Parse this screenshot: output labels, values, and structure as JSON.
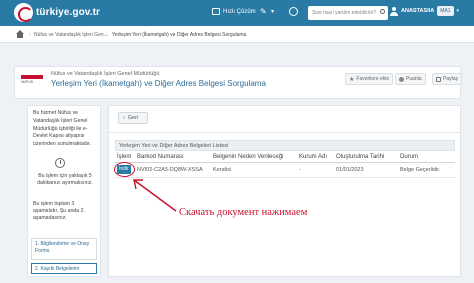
{
  "header": {
    "logo_text": "türkiye.gov.tr",
    "quick_solution": "Hızlı Çözüm",
    "search_placeholder": "Size nasıl yardım edebilirim?",
    "user_name": "ANASTASIIA",
    "user_badge": "MA1"
  },
  "breadcrumb": {
    "item1": "Nüfus ve Vatandaşlık İşleri Gen...",
    "item2": "Yerleşim Yeri (İkametgah) ve Diğer Adres Belgesi Sorgulama"
  },
  "page": {
    "agency": "Nüfus ve Vatandaşlık İşleri Genel Müdürlüğü",
    "agency_logo_text": "NÜFUS",
    "title": "Yerleşim Yeri (İkametgah) ve Diğer Adres Belgesi Sorgulama",
    "favorites_label": "Favorilere ekle",
    "rate_label": "Puanla",
    "share_label": "Paylaş"
  },
  "sidebar": {
    "info": "Bu hizmet Nüfus ve Vatandaşlık İşleri Genel Müdürlüğü işbirliği ile e-Devlet Kapısı altyapısı üzerinden sunulmaktadır.",
    "time_text": "Bu işlem için yaklaşık 5 dakikanızı ayırmalısınız.",
    "steps_text": "Bu işlem toplam 3 aşamalıdır. Şu anda 2. aşamadasınız.",
    "step1": "1. Bilgilendirme ve Onay Formu",
    "step2": "2. Kayıtlı Belgelerim"
  },
  "main": {
    "back_label": "Geri",
    "list_title": "Yerleşim Yeri ve Diğer Adres Belgeleri Listesi",
    "columns": [
      "İşlem",
      "Barkod Numarası",
      "Belgenin Neden Verileceği",
      "Kurum Adı",
      "Oluşturulma Tarihi",
      "Durum"
    ],
    "row": {
      "action": "İndir",
      "barcode": "NVI02-C2A5-DQ8W-XSSA",
      "reason": "Kendisi",
      "institution": "-",
      "date": "01/01/2023",
      "status": "Belge Geçerlidir."
    }
  },
  "annotation": {
    "text": "Скачать документ нажимаем",
    "color": "#c8102e"
  },
  "colors": {
    "brand": "#2a7aa6",
    "title": "#2a6d93"
  }
}
